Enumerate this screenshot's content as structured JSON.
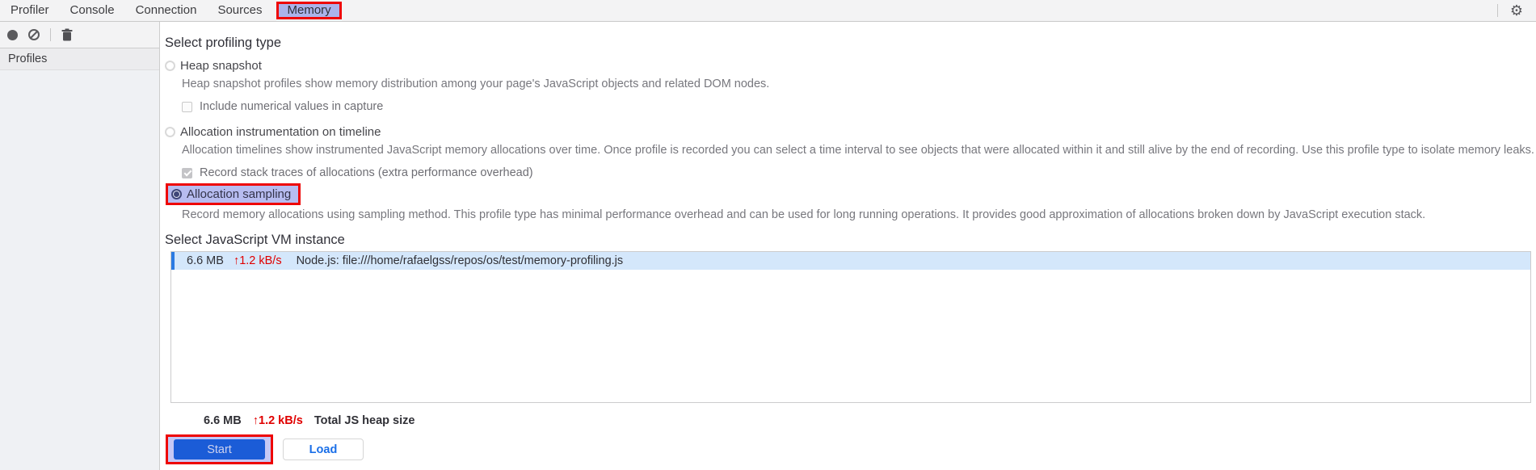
{
  "tabbar": {
    "tabs": [
      {
        "label": "Profiler"
      },
      {
        "label": "Console"
      },
      {
        "label": "Connection"
      },
      {
        "label": "Sources"
      },
      {
        "label": "Memory",
        "active": true
      }
    ]
  },
  "icons": {
    "gear": "⚙"
  },
  "sidebar": {
    "header": "Profiles"
  },
  "profiling": {
    "title": "Select profiling type",
    "options": [
      {
        "label": "Heap snapshot",
        "selected": false,
        "description": "Heap snapshot profiles show memory distribution among your page's JavaScript objects and related DOM nodes.",
        "checkbox": {
          "label": "Include numerical values in capture",
          "checked": false
        }
      },
      {
        "label": "Allocation instrumentation on timeline",
        "selected": false,
        "description": "Allocation timelines show instrumented JavaScript memory allocations over time. Once profile is recorded you can select a time interval to see objects that were allocated within it and still alive by the end of recording. Use this profile type to isolate memory leaks.",
        "checkbox": {
          "label": "Record stack traces of allocations (extra performance overhead)",
          "checked": true
        }
      },
      {
        "label": "Allocation sampling",
        "selected": true,
        "highlighted": true,
        "description": "Record memory allocations using sampling method. This profile type has minimal performance overhead and can be used for long running operations. It provides good approximation of allocations broken down by JavaScript execution stack."
      }
    ]
  },
  "vm": {
    "title": "Select JavaScript VM instance",
    "instances": [
      {
        "size": "6.6 MB",
        "rate": "↑1.2 kB/s",
        "name": "Node.js: file:///home/rafaelgss/repos/os/test/memory-profiling.js"
      }
    ],
    "total": {
      "size": "6.6 MB",
      "rate": "↑1.2 kB/s",
      "label": "Total JS heap size"
    }
  },
  "actions": {
    "start_label": "Start",
    "load_label": "Load"
  },
  "colors": {
    "highlight_red": "#ee0404",
    "highlight_purple": "#b7bcf0",
    "tab_active_bg": "#abb3ea",
    "start_button_blue": "#1b5cd7",
    "load_text_blue": "#1a6fe8",
    "vm_row_bg": "#d4e7fb",
    "vm_row_border_blue": "#2a7ae2",
    "rate_red": "#e00000"
  }
}
